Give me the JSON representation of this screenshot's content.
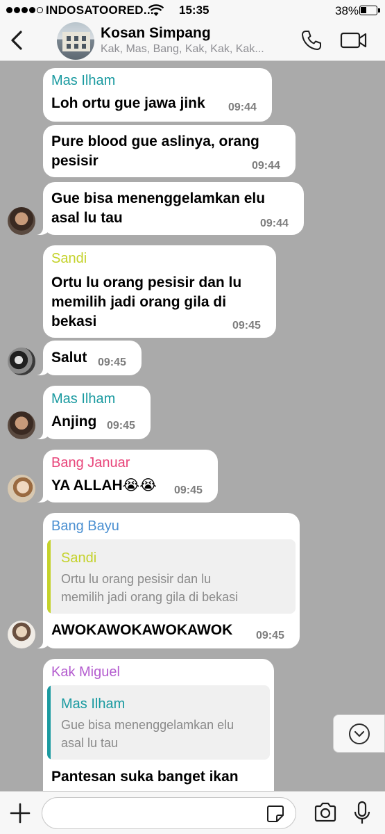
{
  "status": {
    "carrier": "INDOSATOORED...",
    "time": "15:35",
    "battery": "38%",
    "battery_level": 0.38
  },
  "header": {
    "title": "Kosan Simpang",
    "subtitle": "Kak, Mas, Bang, Kak, Kak, Kak..."
  },
  "colors": {
    "mas_ilham": "#1a9aa0",
    "sandi": "#c4d22a",
    "bang_januar": "#e8457a",
    "bang_bayu": "#4a8fd1",
    "kak_miguel": "#b45ccf",
    "chat_bg": "#aaaaaa"
  },
  "messages": [
    {
      "sender": "Mas Ilham",
      "lines": [
        "Loh ortu gue jawa jink"
      ],
      "time": "09:44"
    },
    {
      "lines": [
        "Pure blood gue aslinya, orang",
        "pesisir"
      ],
      "time": "09:44"
    },
    {
      "lines": [
        "Gue bisa menenggelamkan elu",
        "asal lu tau"
      ],
      "time": "09:44"
    },
    {
      "sender": "Sandi",
      "lines": [
        "Ortu lu orang pesisir dan lu",
        "memilih jadi orang gila di",
        "bekasi"
      ],
      "time": "09:45"
    },
    {
      "lines": [
        "Salut"
      ],
      "time": "09:45"
    },
    {
      "sender": "Mas Ilham",
      "lines": [
        "Anjing"
      ],
      "time": "09:45"
    },
    {
      "sender": "Bang Januar",
      "lines": [
        "YA ALLAH😭😭"
      ],
      "time": "09:45"
    },
    {
      "sender": "Bang Bayu",
      "quote": {
        "sender": "Sandi",
        "lines": [
          "Ortu lu orang pesisir dan lu",
          "memilih jadi orang gila di bekasi"
        ]
      },
      "lines": [
        "AWOKAWOKAWOKAWOK"
      ],
      "time": "09:45"
    },
    {
      "sender": "Kak Miguel",
      "quote": {
        "sender": "Mas Ilham",
        "lines": [
          "Gue bisa menenggelamkan elu",
          "asal lu tau"
        ]
      },
      "lines": [
        "Pantesan suka banget ikan"
      ]
    }
  ],
  "input": {
    "placeholder": ""
  },
  "icons": {
    "back": "chevron-left-icon",
    "call": "phone-icon",
    "video": "video-camera-icon",
    "scroll_down": "chevron-down-icon",
    "add": "plus-icon",
    "sticker": "sticker-icon",
    "camera": "camera-icon",
    "mic": "microphone-icon"
  }
}
